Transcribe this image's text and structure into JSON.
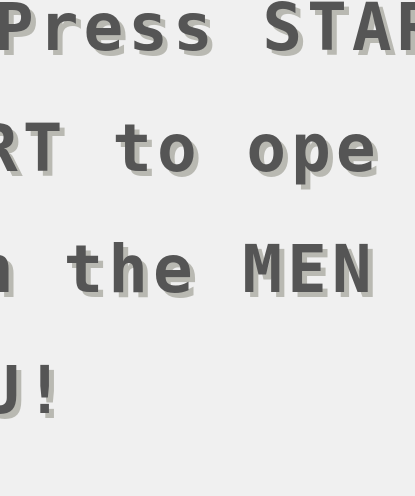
{
  "dialog": {
    "lines": [
      "Press STAR",
      "RT to ope",
      "n the MEN",
      "U!"
    ]
  }
}
